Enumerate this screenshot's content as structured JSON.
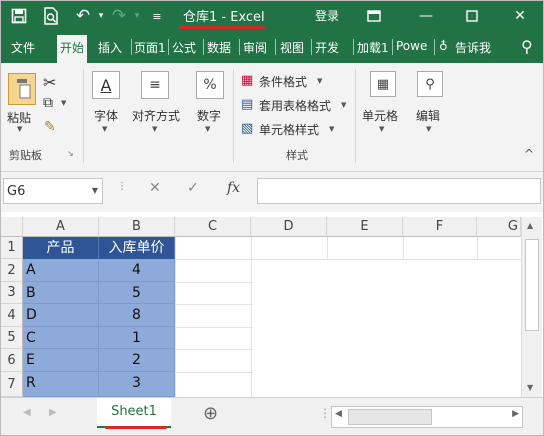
{
  "titlebar": {
    "title": "仓库1 - Excel",
    "login": "登录",
    "icons": [
      "save-icon",
      "print-preview-icon",
      "undo-icon",
      "redo-icon",
      "customize-icon",
      "ribbon-display-icon",
      "minimize-icon",
      "restore-icon",
      "close-icon"
    ]
  },
  "tabs": [
    "文件",
    "开始",
    "插入",
    "页面1",
    "公式",
    "数据",
    "审阅",
    "视图",
    "开发",
    "加载1",
    "Powe",
    "告诉我"
  ],
  "active_tab": "开始",
  "ribbon": {
    "paste": "粘贴",
    "clipboard_group": "剪贴板",
    "font": "字体",
    "alignment": "对齐方式",
    "number": "数字",
    "percent_symbol": "%",
    "conditional_format": "条件格式",
    "table_format": "套用表格格式",
    "cell_style": "单元格样式",
    "styles_group": "样式",
    "cells": "单元格",
    "editing": "编辑"
  },
  "formula_bar": {
    "name_box": "G6",
    "fx": "fx",
    "value": ""
  },
  "sheet": {
    "columns": [
      "A",
      "B",
      "C",
      "D",
      "E",
      "F",
      "G"
    ],
    "rows": [
      "1",
      "2",
      "3",
      "4",
      "5",
      "6",
      "7"
    ],
    "header": [
      "产品",
      "入库单价"
    ],
    "data": [
      [
        "A",
        "4"
      ],
      [
        "B",
        "5"
      ],
      [
        "D",
        "8"
      ],
      [
        "C",
        "1"
      ],
      [
        "E",
        "2"
      ],
      [
        "R",
        "3"
      ]
    ]
  },
  "sheet_tabs": {
    "active": "Sheet1",
    "add": "⊕"
  }
}
